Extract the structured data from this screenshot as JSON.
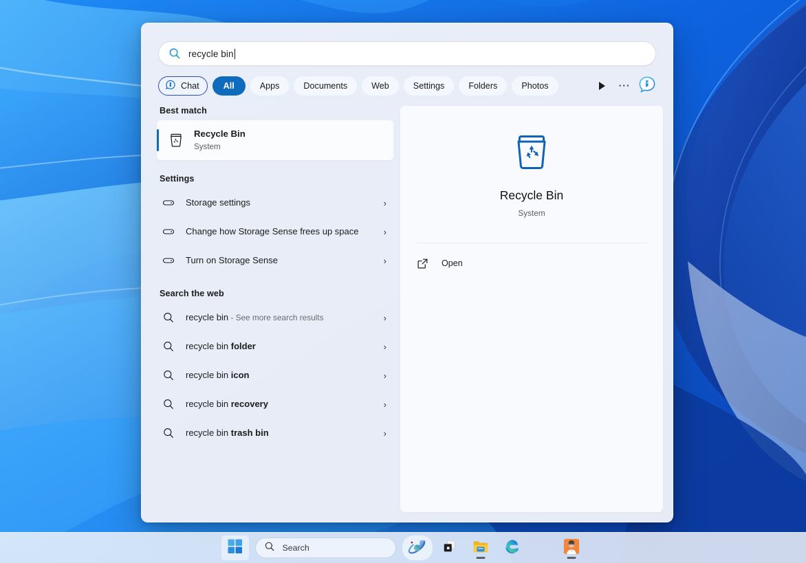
{
  "search_panel": {
    "search_input": {
      "value": "recycle bin",
      "placeholder": "Search",
      "icon": "search-icon"
    },
    "filters": [
      {
        "label": "Chat",
        "icon": "bing-chat-icon",
        "state": "outlined"
      },
      {
        "label": "All",
        "state": "active"
      },
      {
        "label": "Apps",
        "state": "default"
      },
      {
        "label": "Documents",
        "state": "default"
      },
      {
        "label": "Web",
        "state": "default"
      },
      {
        "label": "Settings",
        "state": "default"
      },
      {
        "label": "Folders",
        "state": "default"
      },
      {
        "label": "Photos",
        "state": "default"
      }
    ],
    "filter_overflow": {
      "next_icon": "play-arrow-icon",
      "more_icon": "ellipsis-icon",
      "copilot_icon": "bing-chat-icon"
    },
    "sections": {
      "best_match": {
        "heading": "Best match",
        "item": {
          "title": "Recycle Bin",
          "subtitle": "System",
          "icon": "recycle-bin-icon"
        }
      },
      "settings": {
        "heading": "Settings",
        "items": [
          {
            "label": "Storage settings",
            "icon": "hard-drive-icon",
            "chevron": "›"
          },
          {
            "label": "Change how Storage Sense frees up space",
            "icon": "hard-drive-icon",
            "chevron": "›"
          },
          {
            "label": "Turn on Storage Sense",
            "icon": "hard-drive-icon",
            "chevron": "›"
          }
        ]
      },
      "search_the_web": {
        "heading": "Search the web",
        "items": [
          {
            "query": "recycle bin",
            "suffix": "",
            "note": " - See more search results",
            "icon": "magnifier-icon",
            "chevron": "›"
          },
          {
            "query": "recycle bin ",
            "suffix": "folder",
            "note": "",
            "icon": "magnifier-icon",
            "chevron": "›"
          },
          {
            "query": "recycle bin ",
            "suffix": "icon",
            "note": "",
            "icon": "magnifier-icon",
            "chevron": "›"
          },
          {
            "query": "recycle bin ",
            "suffix": "recovery",
            "note": "",
            "icon": "magnifier-icon",
            "chevron": "›"
          },
          {
            "query": "recycle bin ",
            "suffix": "trash bin",
            "note": "",
            "icon": "magnifier-icon",
            "chevron": "›"
          }
        ]
      }
    },
    "preview": {
      "icon": "recycle-bin-icon",
      "title": "Recycle Bin",
      "subtitle": "System",
      "actions": [
        {
          "label": "Open",
          "icon": "open-external-icon"
        }
      ]
    }
  },
  "taskbar": {
    "start_button": {
      "name": "Start",
      "icon": "windows-logo-icon"
    },
    "search": {
      "placeholder": "Search",
      "icon": "search-icon"
    },
    "items": [
      {
        "name": "Copilot",
        "icon": "copilot-icon",
        "running": false
      },
      {
        "name": "Task View",
        "icon": "task-view-icon",
        "running": false
      },
      {
        "name": "File Explorer",
        "icon": "file-explorer-icon",
        "running": true
      },
      {
        "name": "Microsoft Edge",
        "icon": "edge-icon",
        "running": false
      },
      {
        "name": "Profile App",
        "icon": "person-avatar-icon",
        "running": true
      }
    ]
  },
  "colors": {
    "accent": "#0f6cbd",
    "chat_outline": "#2f4db5",
    "panel_bg": "#e8edf7",
    "preview_bg": "#f9fafd",
    "text_primary": "#1b1b1b",
    "text_secondary": "#5c5c5c",
    "wallpaper_blue": "#0b63dd"
  }
}
